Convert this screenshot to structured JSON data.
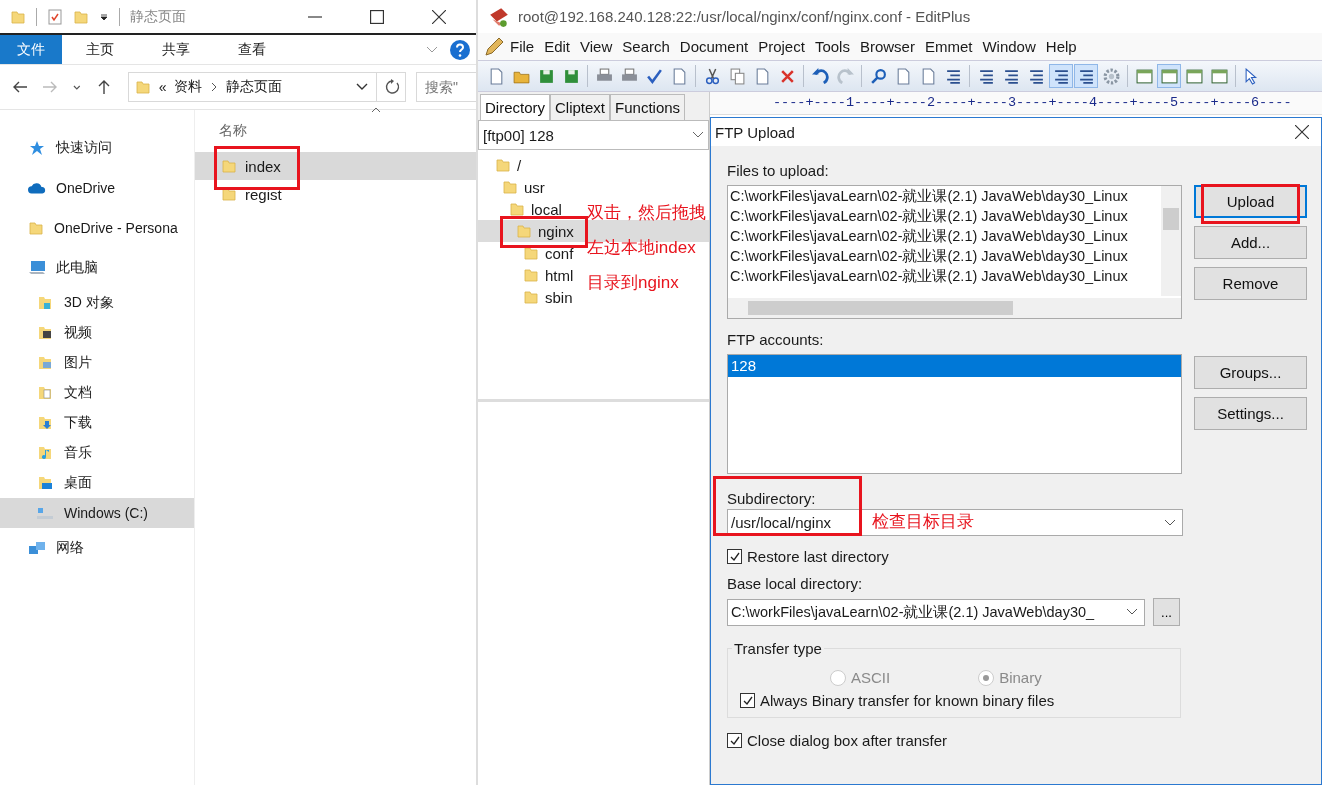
{
  "explorer": {
    "title": "静态页面",
    "ribbon_tabs": [
      {
        "label": "文件",
        "selected": true
      },
      {
        "label": "主页",
        "selected": false
      },
      {
        "label": "共享",
        "selected": false
      },
      {
        "label": "查看",
        "selected": false
      }
    ],
    "breadcrumb": {
      "overflow": "«",
      "parts": [
        "资料",
        "静态页面"
      ]
    },
    "search": {
      "placeholder": "搜索\""
    },
    "nav_items": [
      {
        "label": "快速访问",
        "kind": "star",
        "selected": false
      },
      {
        "label": "OneDrive",
        "kind": "cloud",
        "selected": false
      },
      {
        "label": "OneDrive - Persona",
        "kind": "folder",
        "selected": false
      },
      {
        "label": "此电脑",
        "kind": "pc",
        "selected": false,
        "children": [
          {
            "label": "3D 对象",
            "kind": "cube",
            "selected": false
          },
          {
            "label": "视频",
            "kind": "video",
            "selected": false
          },
          {
            "label": "图片",
            "kind": "picture",
            "selected": false
          },
          {
            "label": "文档",
            "kind": "document",
            "selected": false
          },
          {
            "label": "下载",
            "kind": "download",
            "selected": false
          },
          {
            "label": "音乐",
            "kind": "music",
            "selected": false
          },
          {
            "label": "桌面",
            "kind": "desktop",
            "selected": false
          },
          {
            "label": "Windows (C:)",
            "kind": "drive",
            "selected": true
          }
        ]
      },
      {
        "label": "网络",
        "kind": "network",
        "selected": false
      }
    ],
    "column_header": "名称",
    "files": [
      {
        "name": "index",
        "selected": true
      },
      {
        "name": "regist",
        "selected": false
      }
    ]
  },
  "editplus": {
    "title": "root@192.168.240.128:22:/usr/local/nginx/conf/nginx.conf - EditPlus",
    "menu": [
      "File",
      "Edit",
      "View",
      "Search",
      "Document",
      "Project",
      "Tools",
      "Browser",
      "Emmet",
      "Window",
      "Help"
    ],
    "toolbar": [
      {
        "kind": "page",
        "on": false
      },
      {
        "kind": "folder",
        "on": false
      },
      {
        "kind": "disk",
        "on": false
      },
      {
        "kind": "disk",
        "on": false
      },
      {
        "kind": "printer",
        "on": false
      },
      {
        "kind": "printer",
        "on": false
      },
      {
        "kind": "check",
        "on": false
      },
      {
        "kind": "page",
        "on": false
      },
      {
        "kind": "scissors",
        "on": false
      },
      {
        "kind": "copy",
        "on": false
      },
      {
        "kind": "page",
        "on": false
      },
      {
        "kind": "cross",
        "on": false
      },
      {
        "kind": "undo",
        "on": false
      },
      {
        "kind": "redo",
        "on": false
      },
      {
        "kind": "magnifier",
        "on": false
      },
      {
        "kind": "page",
        "on": false
      },
      {
        "kind": "page",
        "on": false
      },
      {
        "kind": "lines",
        "on": false
      },
      {
        "kind": "lines",
        "on": false
      },
      {
        "kind": "lines",
        "on": false
      },
      {
        "kind": "lines",
        "on": false
      },
      {
        "kind": "lines",
        "on": true
      },
      {
        "kind": "lines",
        "on": true
      },
      {
        "kind": "gear",
        "on": false
      },
      {
        "kind": "window",
        "on": false
      },
      {
        "kind": "window",
        "on": true
      },
      {
        "kind": "window",
        "on": false
      },
      {
        "kind": "window",
        "on": false
      },
      {
        "kind": "pointer",
        "on": false
      }
    ],
    "panel_tabs": [
      {
        "label": "Directory",
        "selected": true
      },
      {
        "label": "Cliptext",
        "selected": false
      },
      {
        "label": "Functions",
        "selected": false
      }
    ],
    "ruler": "----+----1----+----2----+----3----+----4----+----5----+----6----",
    "directory_select": "[ftp00] 128",
    "tree": [
      {
        "name": "/",
        "selected": false,
        "children": [
          {
            "name": "usr",
            "selected": false,
            "children": [
              {
                "name": "local",
                "selected": false,
                "children": [
                  {
                    "name": "nginx",
                    "selected": true,
                    "children": [
                      {
                        "name": "conf",
                        "selected": false
                      },
                      {
                        "name": "html",
                        "selected": false
                      },
                      {
                        "name": "sbin",
                        "selected": false
                      }
                    ]
                  }
                ]
              }
            ]
          }
        ]
      }
    ]
  },
  "ftp_dialog": {
    "title": "FTP Upload",
    "files_label": "Files to upload:",
    "files": [
      "C:\\workFiles\\javaLearn\\02-就业课(2.1) JavaWeb\\day30_Linux",
      "C:\\workFiles\\javaLearn\\02-就业课(2.1) JavaWeb\\day30_Linux",
      "C:\\workFiles\\javaLearn\\02-就业课(2.1) JavaWeb\\day30_Linux",
      "C:\\workFiles\\javaLearn\\02-就业课(2.1) JavaWeb\\day30_Linux",
      "C:\\workFiles\\javaLearn\\02-就业课(2.1) JavaWeb\\day30_Linux"
    ],
    "file_buttons": [
      "Upload",
      "Add...",
      "Remove"
    ],
    "accounts_label": "FTP accounts:",
    "accounts": [
      {
        "name": "128",
        "selected": true
      }
    ],
    "account_buttons": [
      "Groups...",
      "Settings..."
    ],
    "subdirectory": {
      "label": "Subdirectory:",
      "value": "/usr/local/nginx"
    },
    "restore_last": {
      "label": "Restore last directory",
      "checked": true
    },
    "base_local": {
      "label": "Base local directory:",
      "value": "C:\\workFiles\\javaLearn\\02-就业课(2.1) JavaWeb\\day30_",
      "browse": "..."
    },
    "transfer": {
      "title": "Transfer type",
      "options": [
        {
          "label": "ASCII",
          "selected": false,
          "disabled": true
        },
        {
          "label": "Binary",
          "selected": true,
          "disabled": true
        }
      ],
      "always_binary": {
        "label": "Always Binary transfer for known binary files",
        "checked": true
      }
    },
    "close_after": {
      "label": "Close dialog box after transfer",
      "checked": true
    }
  },
  "annotations": [
    {
      "text": "双击，然后拖拽"
    },
    {
      "text": "左边本地index"
    },
    {
      "text": "目录到nginx"
    },
    {
      "text": "检查目标目录"
    }
  ]
}
